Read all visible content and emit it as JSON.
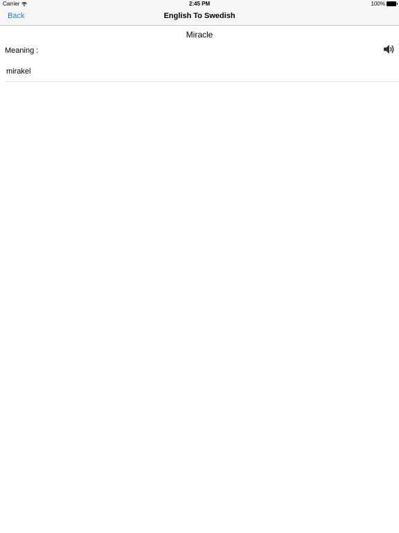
{
  "status_bar": {
    "carrier": "Carrier",
    "time": "2:45 PM",
    "battery": "100%",
    "wifi_icon": "wifi-icon",
    "battery_icon": "battery-icon"
  },
  "nav": {
    "back_label": "Back",
    "title": "English To Swedish"
  },
  "content": {
    "word": "Miracle",
    "meaning_label": "Meaning :",
    "meaning_value": "mirakel",
    "speaker_icon": "speaker-icon"
  },
  "colors": {
    "accent": "#1a7cf2",
    "bar_background": "#f7f7f7"
  }
}
